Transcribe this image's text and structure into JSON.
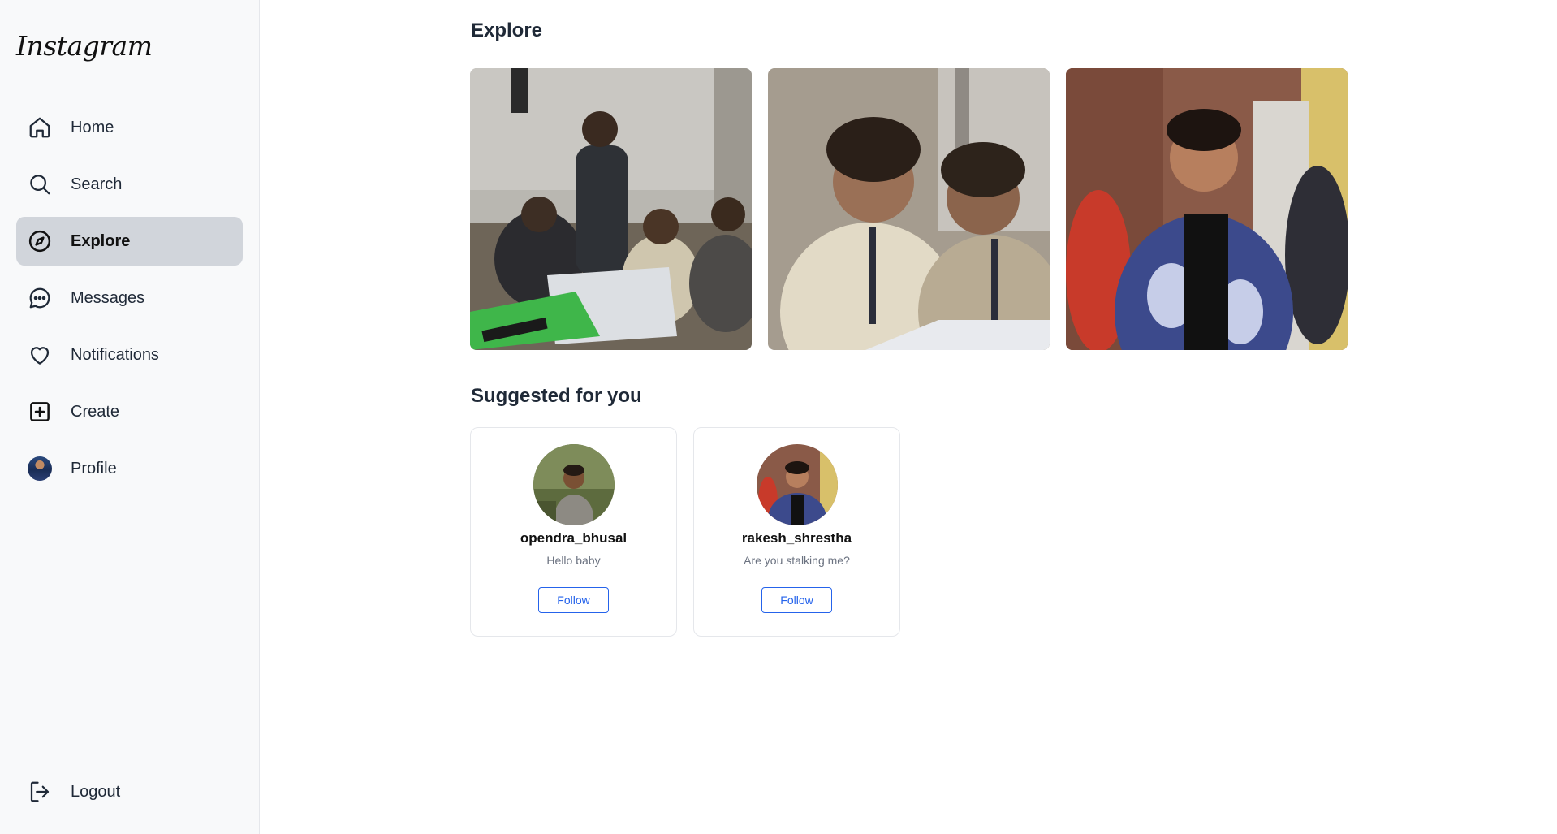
{
  "app": {
    "logo": "Instagram"
  },
  "sidebar": {
    "items": [
      {
        "label": "Home",
        "icon": "home-icon"
      },
      {
        "label": "Search",
        "icon": "search-icon"
      },
      {
        "label": "Explore",
        "icon": "compass-icon",
        "active": true
      },
      {
        "label": "Messages",
        "icon": "message-circle-icon"
      },
      {
        "label": "Notifications",
        "icon": "heart-icon"
      },
      {
        "label": "Create",
        "icon": "plus-square-icon"
      },
      {
        "label": "Profile",
        "icon": "avatar"
      }
    ],
    "logout": {
      "label": "Logout",
      "icon": "logout-icon"
    }
  },
  "explore": {
    "title": "Explore",
    "posts": [
      {
        "alt": "group-at-laptop-photo"
      },
      {
        "alt": "two-people-at-laptop-photo"
      },
      {
        "alt": "man-in-jacket-photo"
      }
    ]
  },
  "suggested": {
    "title": "Suggested for you",
    "users": [
      {
        "username": "opendra_bhusal",
        "bio": "Hello baby",
        "button": "Follow"
      },
      {
        "username": "rakesh_shrestha",
        "bio": "Are you stalking me?",
        "button": "Follow"
      }
    ]
  },
  "colors": {
    "accent": "#2563eb",
    "active_bg": "#d1d5db",
    "sidebar_bg": "#f8f9fa"
  }
}
